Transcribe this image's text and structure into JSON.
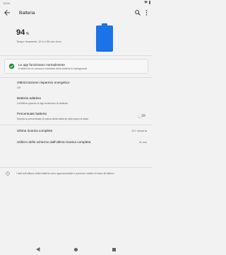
{
  "status_bar": {
    "time": "13:04"
  },
  "app_bar": {
    "title": "Batteria"
  },
  "battery": {
    "percent": "94",
    "percent_symbol": "%",
    "estimate": "Tempo rimanente: 15 h e 56 min circa",
    "color": "#1a73e8"
  },
  "banner": {
    "title": "Le app funzionano normalmente",
    "subtitle": "Il tablet ha un consumo standard della batteria in background",
    "accent": "#1e8e3e"
  },
  "settings": {
    "saver": {
      "title": "Ottimizzazione risparmio energetico",
      "summary": "Off"
    },
    "adaptive": {
      "title": "Batteria adattiva",
      "summary": "On/Attiva quando le app scaricano la batteria"
    },
    "percentage": {
      "title": "Percentuale batteria",
      "summary": "Mostra la percentuale di carica della batteria nella barra di stato",
      "enabled": false
    },
    "last_charge": {
      "title": "Ultima ricarica completa",
      "value": "107 minuti fa"
    },
    "screen_usage": {
      "title": "Utilizzo dello schermo dall'ultima ricarica completa",
      "value": "41 min"
    }
  },
  "info": {
    "text": "I dati sull'utilizzo della batteria sono approssimativi e possono variare in base all'utilizzo"
  }
}
